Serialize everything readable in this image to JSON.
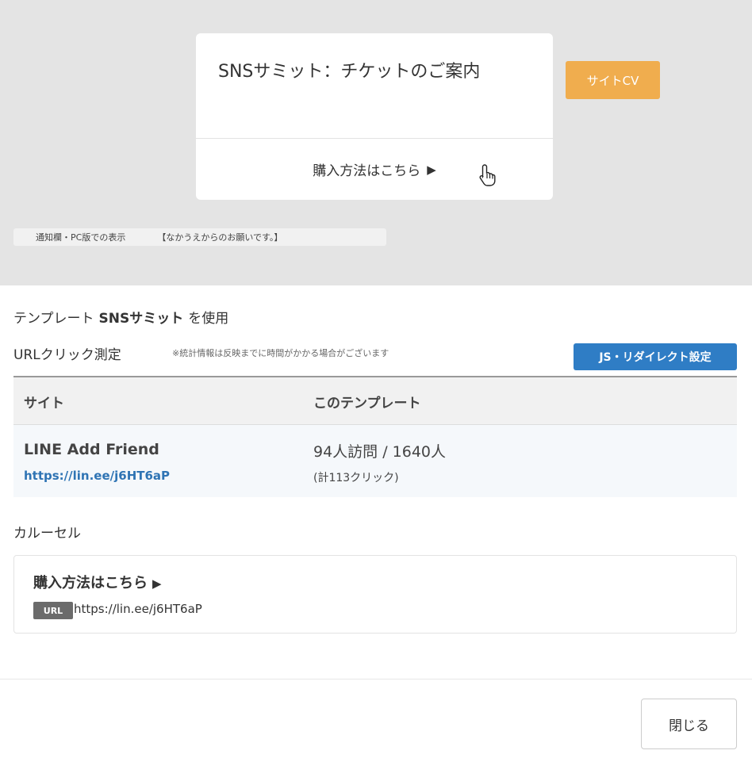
{
  "preview": {
    "card_title": "SNSサミット：チケットのご案内",
    "card_action_label": "購入方法はこちら",
    "card_action_arrow": "▶",
    "caption_left": "通知欄・PC版での表示",
    "caption_right": "【なかうえからのお願いです。】"
  },
  "template_line": {
    "prefix": "テンプレート",
    "name": "SNSサミット",
    "suffix": "を使用"
  },
  "url_click": {
    "title": "URLクリック測定",
    "note": "※統計情報は反映までに時間がかかる場合がございます",
    "js_button": "JS・リダイレクト設定"
  },
  "table": {
    "headers": [
      "サイト",
      "このテンプレート"
    ],
    "row": {
      "site_name": "LINE Add Friend",
      "site_url": "https://lin.ee/j6HT6aP",
      "visits": "94人訪問 / 1640人",
      "clicks": "(計113クリック)",
      "cv_button": "サイトCV"
    }
  },
  "carousel": {
    "label": "カルーセル",
    "item_title": "購入方法はこちら",
    "item_arrow": "▶",
    "url_badge": "URL",
    "item_url": "https://lin.ee/j6HT6aP"
  },
  "footer": {
    "close_label": "閉じる"
  },
  "colors": {
    "accent_blue": "#2f7dc5",
    "cv_orange": "#f0ad4e",
    "link_blue": "#2f74b4"
  }
}
